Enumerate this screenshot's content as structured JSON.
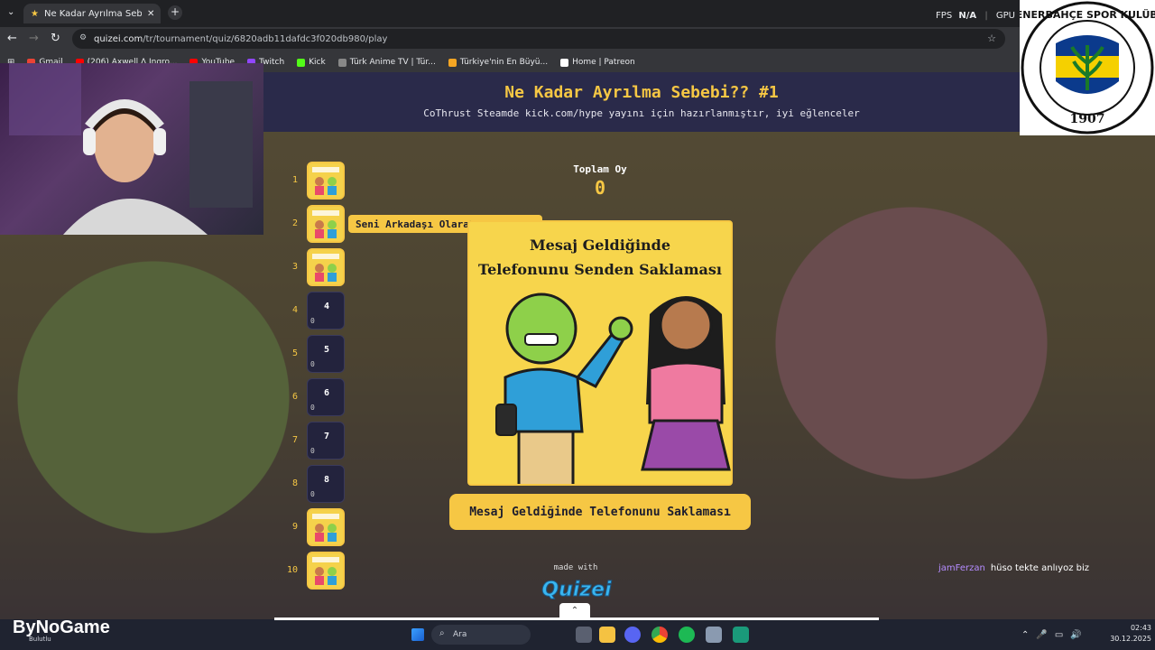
{
  "browser": {
    "tab_title": "Ne Kadar Ayrılma Sebebi?? #1",
    "url_host": "quizei.com",
    "url_path": "/tr/tournament/quiz/6820adb11dafdc3f020db980/play",
    "fps_label": "FPS",
    "fps_value": "N/A",
    "gpu_label": "GPU",
    "bookmarks": [
      {
        "label": "Gmail",
        "color": "#ea4335"
      },
      {
        "label": "(206) Axwell Λ Ingro...",
        "color": "#ff0000"
      },
      {
        "label": "YouTube",
        "color": "#ff0000"
      },
      {
        "label": "Twitch",
        "color": "#9146ff"
      },
      {
        "label": "Kick",
        "color": "#53fc18"
      },
      {
        "label": "Türk Anime TV | Tür...",
        "color": "#888888"
      },
      {
        "label": "Türkiye'nin En Büyü...",
        "color": "#f5a623"
      },
      {
        "label": "Home | Patreon",
        "color": "#ffffff"
      }
    ]
  },
  "quiz": {
    "title": "Ne Kadar Ayrılma Sebebi?? #1",
    "subtitle": "CoThrust Steamde kick.com/hype yayını için hazırlanmıştır, iyi eğlenceler",
    "total_votes_label": "Toplam Oy",
    "total_votes_value": "0",
    "tooltip": "Seni Arkadaşı Olarak Tanıtması",
    "card_title_line1": "Mesaj Geldiğinde",
    "card_title_line2": "Telefonunu Senden Saklaması",
    "answer_button": "Mesaj Geldiğinde Telefonunu Saklaması",
    "made_with": "made with",
    "logo_text": "QUIZEI",
    "slots": [
      {
        "num": "1",
        "filled": true
      },
      {
        "num": "2",
        "filled": true
      },
      {
        "num": "3",
        "filled": true
      },
      {
        "num": "4",
        "filled": false,
        "value": "0"
      },
      {
        "num": "5",
        "filled": false,
        "value": "0"
      },
      {
        "num": "6",
        "filled": false,
        "value": "0"
      },
      {
        "num": "7",
        "filled": false,
        "value": "0"
      },
      {
        "num": "8",
        "filled": false,
        "value": "0"
      },
      {
        "num": "9",
        "filled": true
      },
      {
        "num": "10",
        "filled": true
      }
    ]
  },
  "chat": {
    "user": "jamFerzan",
    "message": "hüso tekte anlıyoz biz"
  },
  "overlay": {
    "crest_top": "FENERBAHÇE SPOR KULÜBÜ",
    "crest_year": "1907",
    "brand": "ByNoGame",
    "weather_label": "Bulutlu"
  },
  "taskbar": {
    "search_placeholder": "Ara",
    "time": "02:43",
    "date": "30.12.2025"
  },
  "colors": {
    "accent": "#f6c744",
    "header_bg": "#2a2a4a",
    "slot_bg": "#23233d"
  }
}
